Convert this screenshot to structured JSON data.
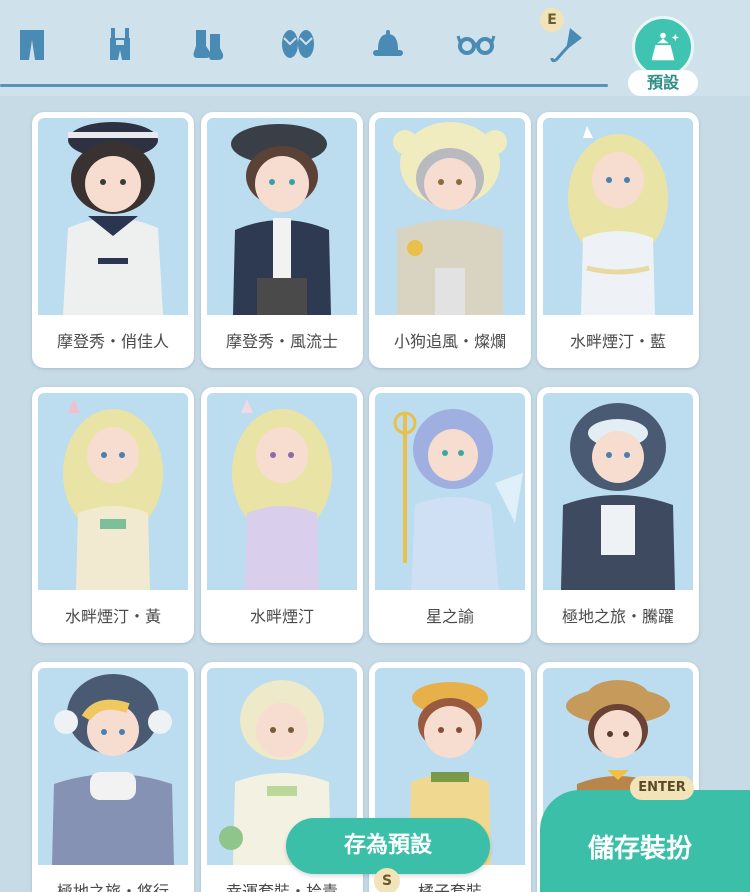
{
  "category_tabs": [
    {
      "name": "pants-tab",
      "icon": "pants-icon"
    },
    {
      "name": "overalls-tab",
      "icon": "overalls-icon"
    },
    {
      "name": "socks-tab",
      "icon": "socks-icon"
    },
    {
      "name": "shoes-tab",
      "icon": "shoes-icon"
    },
    {
      "name": "hat-tab",
      "icon": "hat-icon"
    },
    {
      "name": "glasses-tab",
      "icon": "glasses-icon"
    },
    {
      "name": "umbrella-tab",
      "icon": "umbrella-icon"
    }
  ],
  "key_hints": {
    "tab": "E",
    "save_preset": "S",
    "save_outfit": "ENTER"
  },
  "preset_tab": {
    "label": "預設",
    "icon": "preset-outfit-icon"
  },
  "outfits": [
    {
      "label": "摩登秀・俏佳人"
    },
    {
      "label": "摩登秀・風流士"
    },
    {
      "label": "小狗追風・燦爛"
    },
    {
      "label": "水畔煙汀・藍"
    },
    {
      "label": "水畔煙汀・黃"
    },
    {
      "label": "水畔煙汀"
    },
    {
      "label": "星之諭"
    },
    {
      "label": "極地之旅・騰躍"
    },
    {
      "label": "極地之旅・悠行"
    },
    {
      "label": "幸運套裝・拾青"
    },
    {
      "label": "橘子套裝"
    },
    {
      "label": ""
    }
  ],
  "buttons": {
    "save_preset": "存為預設",
    "save_outfit": "儲存裝扮"
  },
  "colors": {
    "accent": "#3bbfa9",
    "icon": "#4a8bb5",
    "background": "#c6dbe6"
  }
}
